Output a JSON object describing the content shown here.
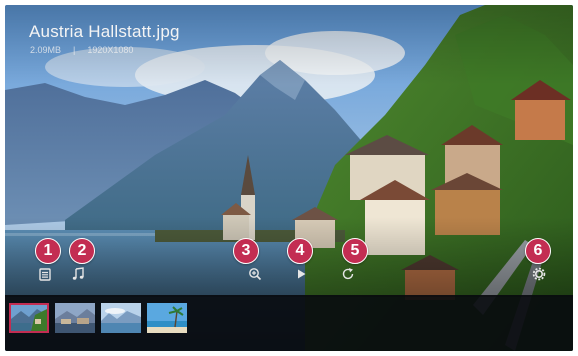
{
  "viewer": {
    "file_name": "Austria Hallstatt.jpg",
    "file_size": "2.09MB",
    "separator": "|",
    "resolution": "1920X1080"
  },
  "controls": {
    "photo_list": {
      "icon": "list-icon",
      "callout": "1"
    },
    "music": {
      "icon": "music-note-icon",
      "callout": "2"
    },
    "zoom": {
      "icon": "zoom-in-icon",
      "callout": "3"
    },
    "slideshow": {
      "icon": "play-icon",
      "callout": "4"
    },
    "rotate": {
      "icon": "rotate-icon",
      "callout": "5"
    },
    "settings": {
      "icon": "gear-icon",
      "callout": "6"
    }
  },
  "filmstrip": {
    "thumbnails": [
      {
        "selected": true
      },
      {
        "selected": false
      },
      {
        "selected": false
      },
      {
        "selected": false
      }
    ]
  },
  "colors": {
    "accent": "#c32d52",
    "filmstrip_bg": "#0a0c10",
    "sky": "#6fa3d4"
  }
}
